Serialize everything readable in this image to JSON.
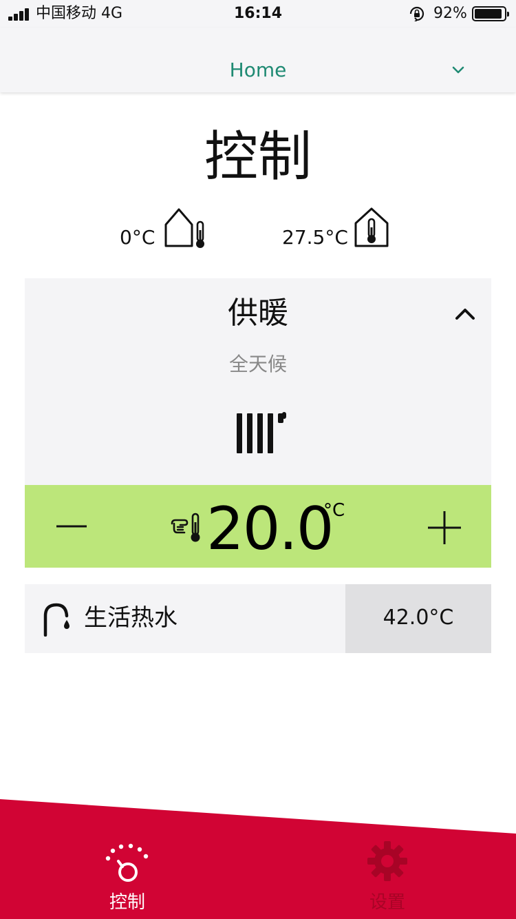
{
  "status_bar": {
    "carrier": "中国移动  4G",
    "time": "16:14",
    "battery_percent": "92%",
    "battery_level": 0.92
  },
  "nav": {
    "title": "Home"
  },
  "page": {
    "title": "控制"
  },
  "temperatures": {
    "outdoor": "0°C",
    "indoor": "27.5°C"
  },
  "heating": {
    "title": "供暖",
    "mode": "全天候",
    "setpoint": "20.0",
    "unit": "°C"
  },
  "hot_water": {
    "label": "生活热水",
    "value": "42.0°C"
  },
  "tabs": [
    {
      "label": "控制",
      "active": true
    },
    {
      "label": "设置",
      "active": false
    }
  ],
  "colors": {
    "accent": "#1f8a73",
    "setpoint_bar": "#bce67a",
    "tab_bar": "#d10434",
    "card": "#f4f4f6"
  }
}
